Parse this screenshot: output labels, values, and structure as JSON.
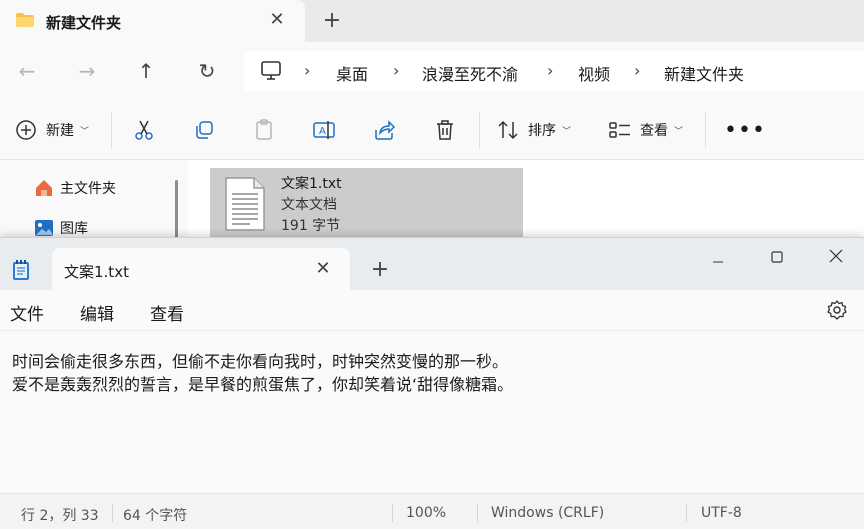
{
  "explorer": {
    "tab_title": "新建文件夹",
    "breadcrumbs": [
      "桌面",
      "浪漫至死不渝",
      "视频",
      "新建文件夹"
    ],
    "toolbar": {
      "new_label": "新建",
      "sort_label": "排序",
      "view_label": "查看"
    },
    "sidebar": [
      {
        "label": "主文件夹",
        "icon": "home-icon"
      },
      {
        "label": "图库",
        "icon": "gallery-icon"
      }
    ],
    "file": {
      "name": "文案1.txt",
      "type": "文本文档",
      "size": "191 字节"
    }
  },
  "notepad": {
    "tab_title": "文案1.txt",
    "menu": [
      "文件",
      "编辑",
      "查看"
    ],
    "lines": [
      "时间会偷走很多东西，但偷不走你看向我时，时钟突然变慢的那一秒。",
      "爱不是轰轰烈烈的誓言，是早餐的煎蛋焦了，你却笑着说‘甜得像糖霜。"
    ],
    "status": {
      "position": "行 2，列 33",
      "chars": "64 个字符",
      "zoom": "100%",
      "line_ending": "Windows (CRLF)",
      "encoding": "UTF-8"
    }
  },
  "colors": {
    "folder": "#f8c24a",
    "accent": "#0067c0",
    "selected_tile": "#cccccc"
  }
}
